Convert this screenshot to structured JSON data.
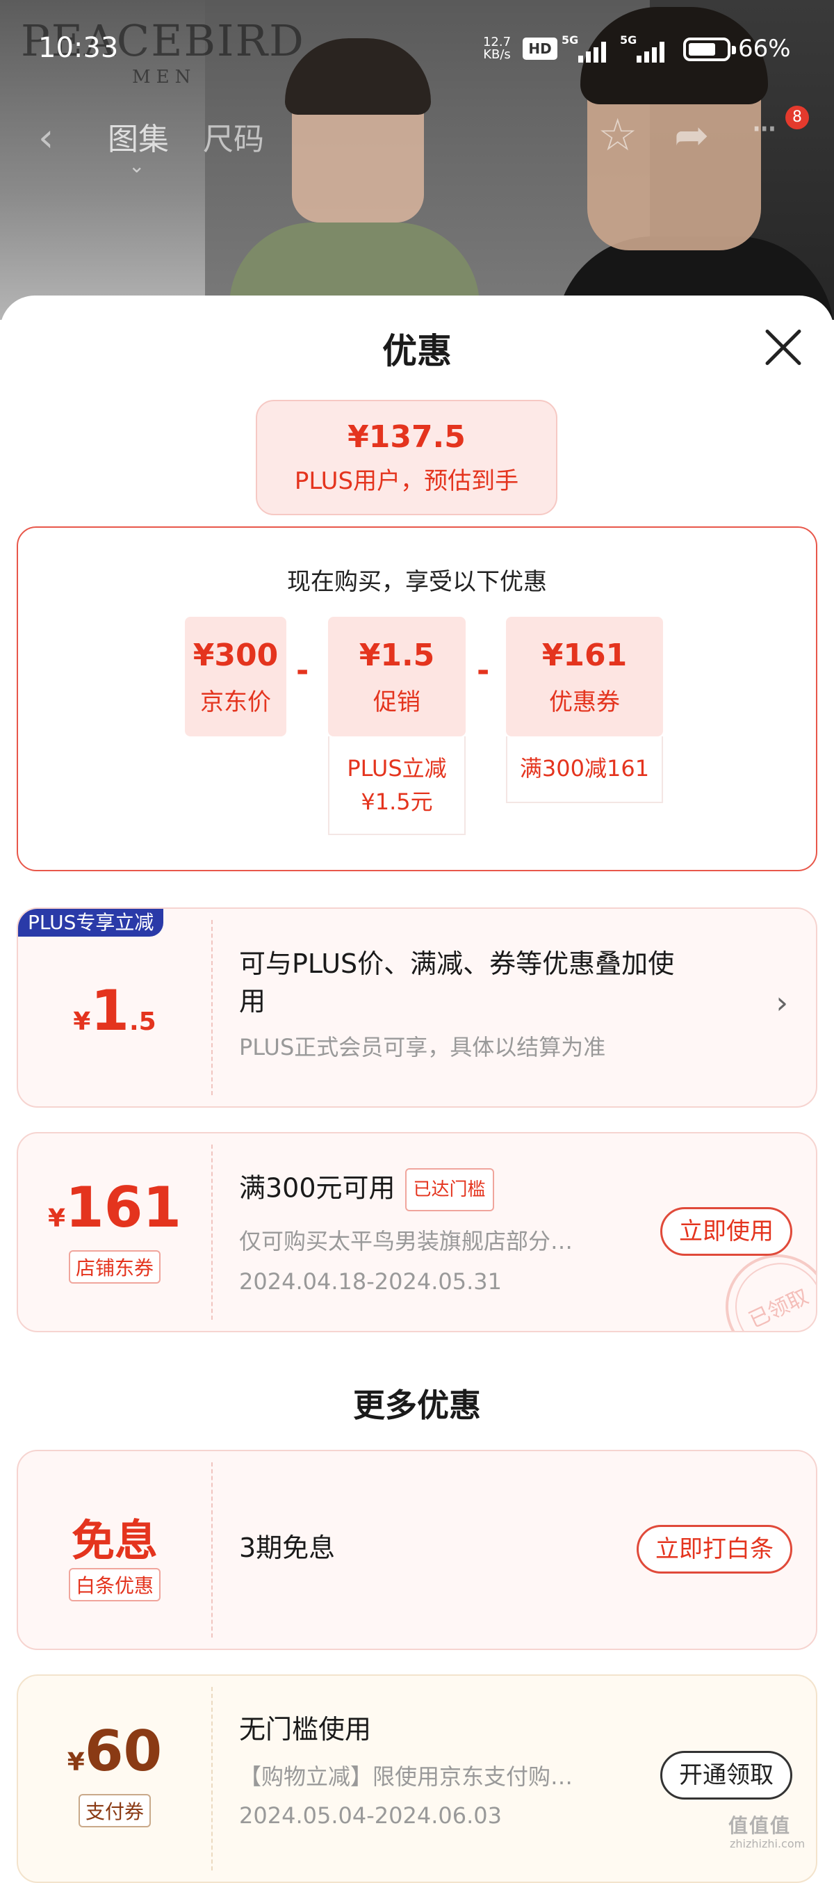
{
  "status_bar": {
    "time": "10:33",
    "net_speed_top": "12.7",
    "net_speed_unit": "KB/s",
    "hd": "HD",
    "sim1": "5G",
    "sim2": "5G",
    "battery": "66%"
  },
  "brand": {
    "name": "PEACEBIRD",
    "sub": "MEN"
  },
  "nav": {
    "tab_gallery": "图集",
    "tab_size": "尺码",
    "notification_count": "8"
  },
  "sheet": {
    "title": "优惠",
    "estimate": {
      "price": "¥137.5",
      "label": "PLUS用户，预估到手"
    },
    "breakdown": {
      "heading": "现在购买，享受以下优惠",
      "items": [
        {
          "amount": "¥300",
          "label": "京东价"
        },
        {
          "amount": "¥1.5",
          "label": "促销",
          "note": "PLUS立减\n¥1.5元"
        },
        {
          "amount": "¥161",
          "label": "优惠券",
          "note": "满300减161"
        }
      ],
      "operator": "-"
    },
    "plus_card": {
      "badge": "PLUS专享立减",
      "yen": "¥",
      "amount_int": "1",
      "amount_dec": ".5",
      "title": "可与PLUS价、满减、券等优惠叠加使用",
      "subtitle": "PLUS正式会员可享，具体以结算为准"
    },
    "shop_coupon": {
      "yen": "¥",
      "amount": "161",
      "tag": "店铺东券",
      "title": "满300元可用",
      "reached": "已达门槛",
      "desc": "仅可购买太平鸟男装旗舰店部分…",
      "dates": "2024.04.18-2024.05.31",
      "button": "立即使用",
      "stamp": "已领取"
    },
    "more_title": "更多优惠",
    "baitiao_card": {
      "amount": "免息",
      "tag": "白条优惠",
      "title": "3期免息",
      "button": "立即打白条"
    },
    "pay_card": {
      "yen": "¥",
      "amount": "60",
      "tag": "支付券",
      "title": "无门槛使用",
      "desc": "【购物立减】限使用京东支付购…",
      "dates": "2024.05.04-2024.06.03",
      "button": "开通领取"
    }
  },
  "watermark": {
    "text": "值值值",
    "sub": "zhizhizhi.com"
  }
}
